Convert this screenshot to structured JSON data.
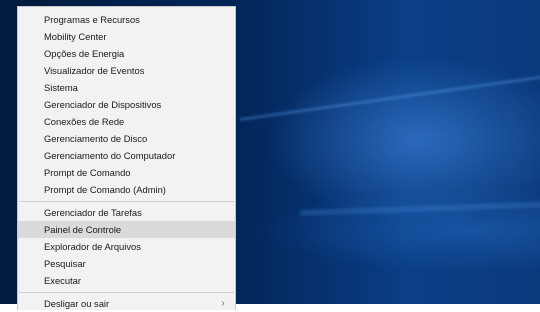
{
  "menu": {
    "group1": [
      {
        "label": "Programas e Recursos"
      },
      {
        "label": "Mobility Center"
      },
      {
        "label": "Opções de Energia"
      },
      {
        "label": "Visualizador de Eventos"
      },
      {
        "label": "Sistema"
      },
      {
        "label": "Gerenciador de Dispositivos"
      },
      {
        "label": "Conexões de Rede"
      },
      {
        "label": "Gerenciamento de Disco"
      },
      {
        "label": "Gerenciamento do Computador"
      },
      {
        "label": "Prompt de Comando"
      },
      {
        "label": "Prompt de Comando (Admin)"
      }
    ],
    "group2": [
      {
        "label": "Gerenciador de Tarefas"
      },
      {
        "label": "Painel de Controle",
        "selected": true
      },
      {
        "label": "Explorador de Arquivos"
      },
      {
        "label": "Pesquisar"
      },
      {
        "label": "Executar"
      }
    ],
    "group3": [
      {
        "label": "Desligar ou sair",
        "submenu_icon": "chevron-right-icon"
      }
    ]
  }
}
